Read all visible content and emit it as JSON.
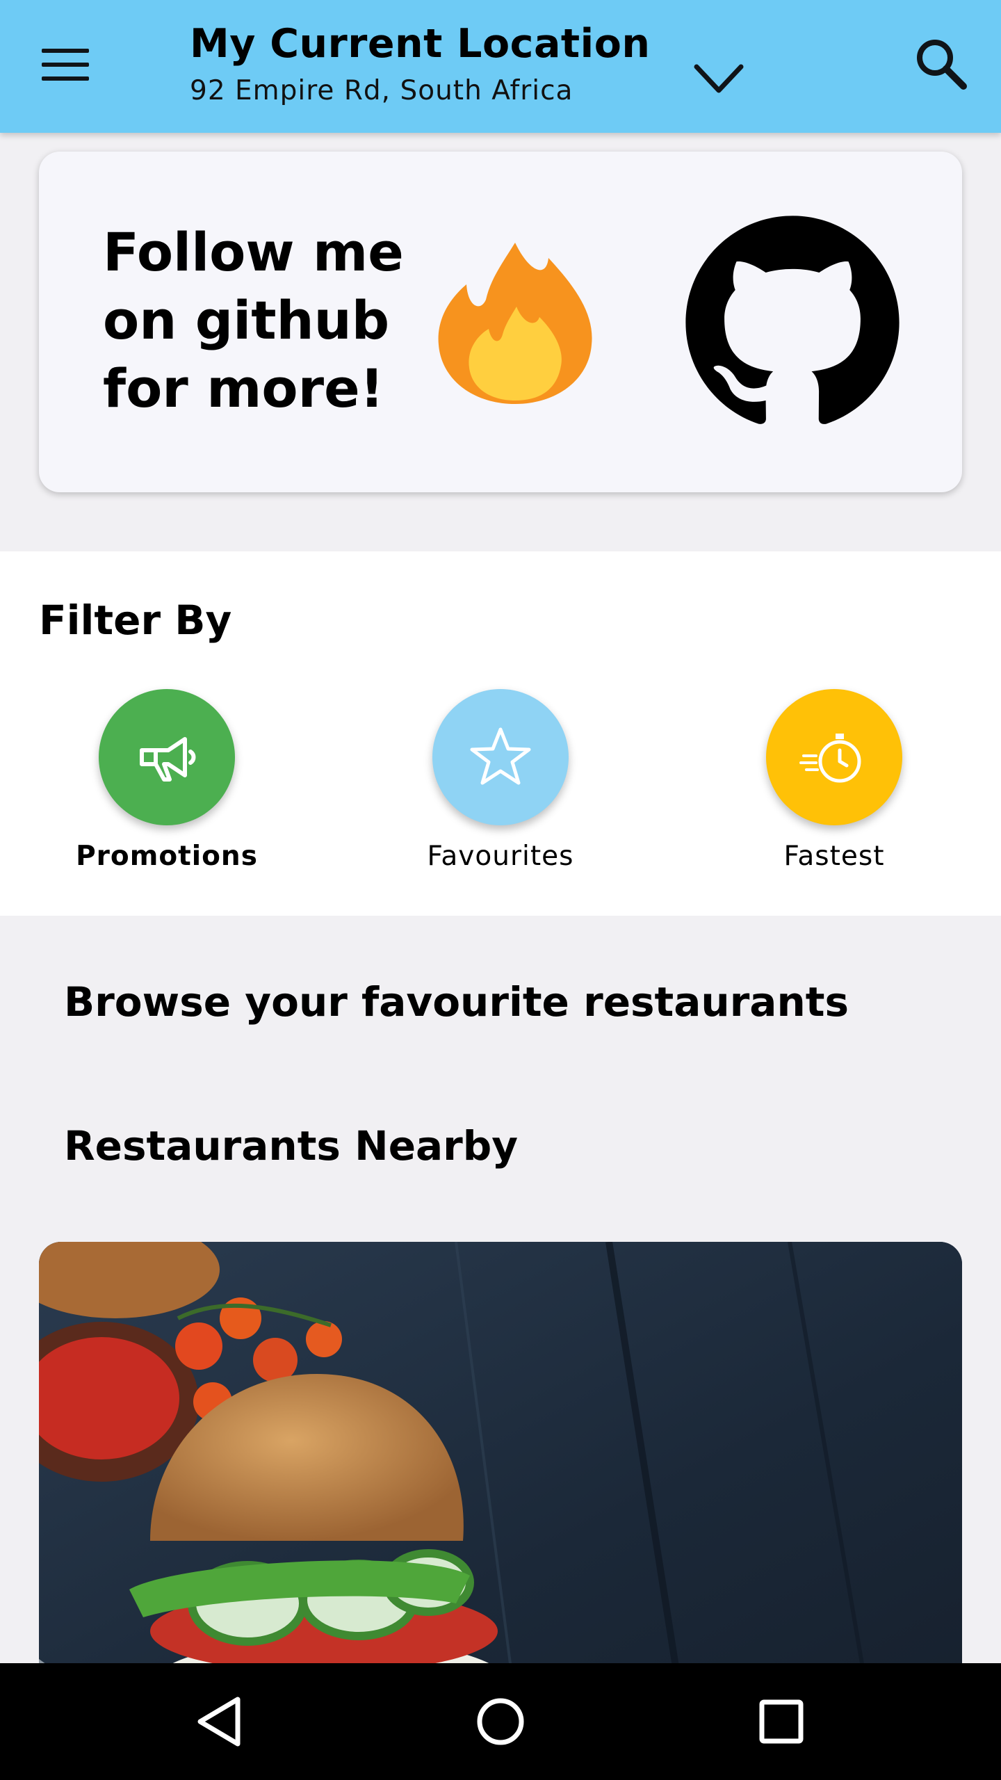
{
  "app_bar": {
    "title": "My Current Location",
    "subtitle": "92 Empire Rd, South Africa",
    "icons": [
      "menu-icon",
      "chevron-down-icon",
      "search-icon"
    ],
    "color": "#6ecbf5"
  },
  "banner": {
    "line1": "Follow me",
    "line2": "on github",
    "line3": "for more!",
    "icons": [
      "fire-emoji",
      "github-logo"
    ]
  },
  "filter": {
    "title": "Filter By",
    "items": [
      {
        "label": "Promotions",
        "icon": "megaphone-icon",
        "color": "#4caf50",
        "selected": true
      },
      {
        "label": "Favourites",
        "icon": "star-icon",
        "color": "#8fd3f4",
        "selected": false
      },
      {
        "label": "Fastest",
        "icon": "stopwatch-icon",
        "color": "#ffc107",
        "selected": false
      }
    ]
  },
  "sections": {
    "browse": "Browse your favourite restaurants",
    "nearby": "Restaurants Nearby"
  },
  "restaurant_card": {
    "image": "burger-photo"
  },
  "system_nav": {
    "buttons": [
      "back-icon",
      "home-icon",
      "recents-icon"
    ]
  }
}
